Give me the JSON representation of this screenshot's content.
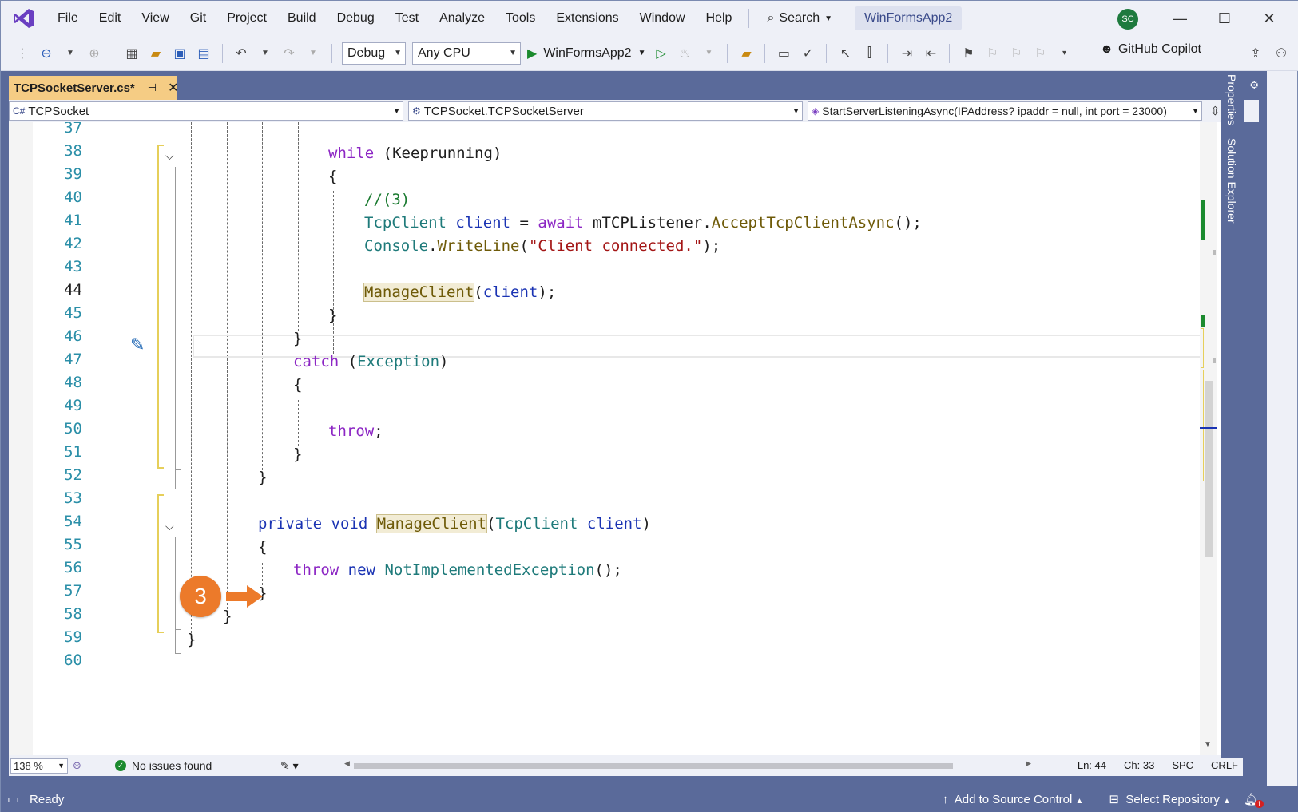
{
  "menu": [
    "File",
    "Edit",
    "View",
    "Git",
    "Project",
    "Build",
    "Debug",
    "Test",
    "Analyze",
    "Tools",
    "Extensions",
    "Window",
    "Help"
  ],
  "search_label": "Search",
  "project_title": "WinFormsApp2",
  "avatar_initials": "SC",
  "toolbar": {
    "config": "Debug",
    "platform": "Any CPU",
    "run_target": "WinFormsApp2",
    "copilot_label": "GitHub Copilot"
  },
  "tab": {
    "file": "TCPSocketServer.cs*"
  },
  "nav": {
    "project": "TCPSocket",
    "class": "TCPSocket.TCPSocketServer",
    "member": "StartServerListeningAsync(IPAddress? ipaddr = null, int port = 23000)"
  },
  "line_numbers": [
    "37",
    "38",
    "39",
    "40",
    "41",
    "42",
    "43",
    "44",
    "45",
    "46",
    "47",
    "48",
    "49",
    "50",
    "51",
    "52",
    "53",
    "54",
    "55",
    "56",
    "57",
    "58",
    "59",
    "60"
  ],
  "current_line": "44",
  "annotation_badge": "3",
  "bottom": {
    "zoom": "138 %",
    "issues": "No issues found",
    "ln": "Ln: 44",
    "ch": "Ch: 33",
    "spc": "SPC",
    "crlf": "CRLF"
  },
  "side_tabs": {
    "properties": "Properties",
    "solution_explorer": "Solution Explorer"
  },
  "status": {
    "ready": "Ready",
    "add_source": "Add to Source Control",
    "select_repo": "Select Repository",
    "notif_count": "1"
  },
  "colors": {
    "accent": "#5a6a9a",
    "tab_active": "#f5cc84",
    "badge": "#ec7a2a"
  }
}
